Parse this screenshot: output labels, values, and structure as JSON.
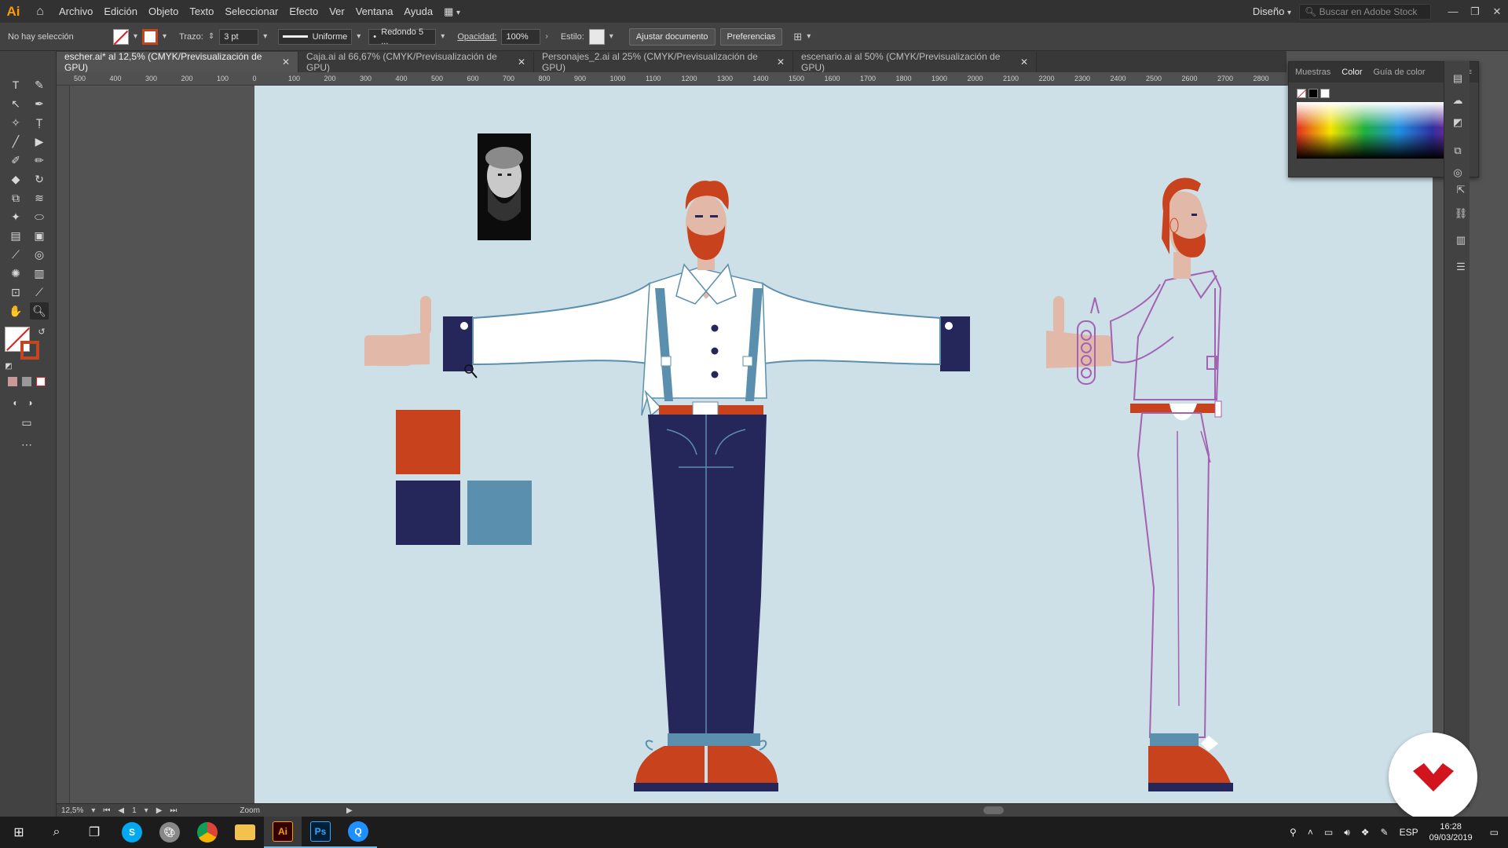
{
  "app": {
    "logo": "Ai",
    "workspace": "Diseño",
    "stock_placeholder": "Buscar en Adobe Stock"
  },
  "menu": [
    "Archivo",
    "Edición",
    "Objeto",
    "Texto",
    "Seleccionar",
    "Efecto",
    "Ver",
    "Ventana",
    "Ayuda"
  ],
  "control": {
    "selection": "No hay selección",
    "stroke_label": "Trazo:",
    "stroke_weight": "3 pt",
    "profile": "Uniforme",
    "brush": "Redondo 5 ...",
    "opacity_label": "Opacidad:",
    "opacity": "100%",
    "style_label": "Estilo:",
    "adjust_button": "Ajustar documento",
    "prefs_button": "Preferencias"
  },
  "tabs": [
    {
      "label": "escher.ai* al 12,5% (CMYK/Previsualización de GPU)",
      "active": true
    },
    {
      "label": "Caja.ai al 66,67% (CMYK/Previsualización de GPU)",
      "active": false
    },
    {
      "label": "Personajes_2.ai al 25% (CMYK/Previsualización de GPU)",
      "active": false
    },
    {
      "label": "escenario.ai al 50% (CMYK/Previsualización de GPU)",
      "active": false
    }
  ],
  "ruler_top": [
    "500",
    "400",
    "300",
    "200",
    "100",
    "0",
    "100",
    "200",
    "300",
    "400",
    "500",
    "600",
    "700",
    "800",
    "900",
    "1000",
    "1100",
    "1200",
    "1300",
    "1400",
    "1500",
    "1600",
    "1700",
    "1800",
    "1900",
    "2000",
    "2100",
    "2200",
    "2300",
    "2400",
    "2500",
    "2600",
    "2700",
    "2800"
  ],
  "color_panel": {
    "tabs": [
      "Muestras",
      "Color",
      "Guía de color"
    ],
    "active_tab": "Color"
  },
  "status": {
    "zoom": "12,5%",
    "artboard": "1",
    "tool": "Zoom"
  },
  "taskbar": {
    "language": "ESP",
    "time": "16:28",
    "date": "09/03/2019"
  },
  "colors": {
    "artboard": "#cddfe7",
    "orange": "#c8431d",
    "navy": "#25265a",
    "steel": "#5b8fae",
    "skin": "#e2b9a8",
    "outline": "#a362b2"
  },
  "icons": {
    "home": "home-icon",
    "search": "search-icon",
    "close": "close-icon",
    "windows": "windows-icon",
    "illustrator": "illustrator-icon",
    "photoshop": "photoshop-icon"
  }
}
